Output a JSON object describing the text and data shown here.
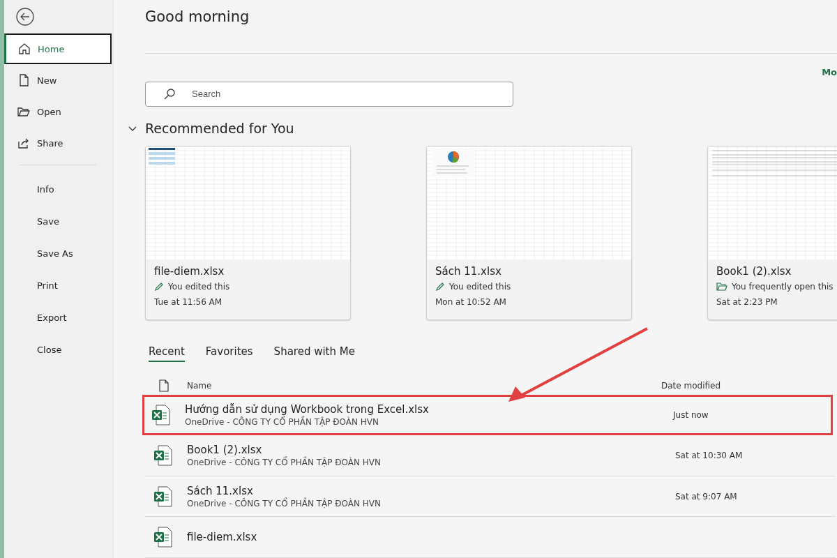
{
  "sidebar": {
    "items": [
      {
        "label": "Home",
        "kind": "icon",
        "selected": true
      },
      {
        "label": "New",
        "kind": "icon",
        "selected": false
      },
      {
        "label": "Open",
        "kind": "icon",
        "selected": false
      },
      {
        "label": "Share",
        "kind": "icon",
        "selected": false
      },
      {
        "label": "Info",
        "kind": "plain",
        "selected": false
      },
      {
        "label": "Save",
        "kind": "plain",
        "selected": false
      },
      {
        "label": "Save As",
        "kind": "plain",
        "selected": false
      },
      {
        "label": "Print",
        "kind": "plain",
        "selected": false
      },
      {
        "label": "Export",
        "kind": "plain",
        "selected": false
      },
      {
        "label": "Close",
        "kind": "plain",
        "selected": false
      }
    ]
  },
  "greeting": "Good morning",
  "more_link": "Mo",
  "search": {
    "placeholder": "Search"
  },
  "recommended": {
    "title": "Recommended for You",
    "expanded": true,
    "cards": [
      {
        "name": "file-diem.xlsx",
        "reason": "You edited this",
        "kind": "edited",
        "time": "Tue at 11:56 AM"
      },
      {
        "name": "Sách 11.xlsx",
        "reason": "You edited this",
        "kind": "edited",
        "time": "Mon at 10:52 AM"
      },
      {
        "name": "Book1 (2).xlsx",
        "reason": "You frequently open this",
        "kind": "opened",
        "time": "Sat at 2:23 PM"
      }
    ]
  },
  "tabs": [
    {
      "label": "Recent",
      "selected": true
    },
    {
      "label": "Favorites",
      "selected": false
    },
    {
      "label": "Shared with Me",
      "selected": false
    }
  ],
  "files": {
    "columns": [
      "Name",
      "Date modified"
    ],
    "rows": [
      {
        "name": "Hướng dẫn sử dụng Workbook trong Excel.xlsx",
        "location": "OneDrive - CÔNG TY CỔ PHẦN TẬP ĐOÀN HVN",
        "date": "Just now",
        "highlighted": true
      },
      {
        "name": "Book1 (2).xlsx",
        "location": "OneDrive - CÔNG TY CỔ PHẦN TẬP ĐOÀN HVN",
        "date": "Sat at 10:30 AM",
        "highlighted": false
      },
      {
        "name": "Sách 11.xlsx",
        "location": "OneDrive - CÔNG TY CỔ PHẦN TẬP ĐOÀN HVN",
        "date": "Sat at 9:07 AM",
        "highlighted": false
      },
      {
        "name": "file-diem.xlsx",
        "highlighted": false
      }
    ]
  }
}
